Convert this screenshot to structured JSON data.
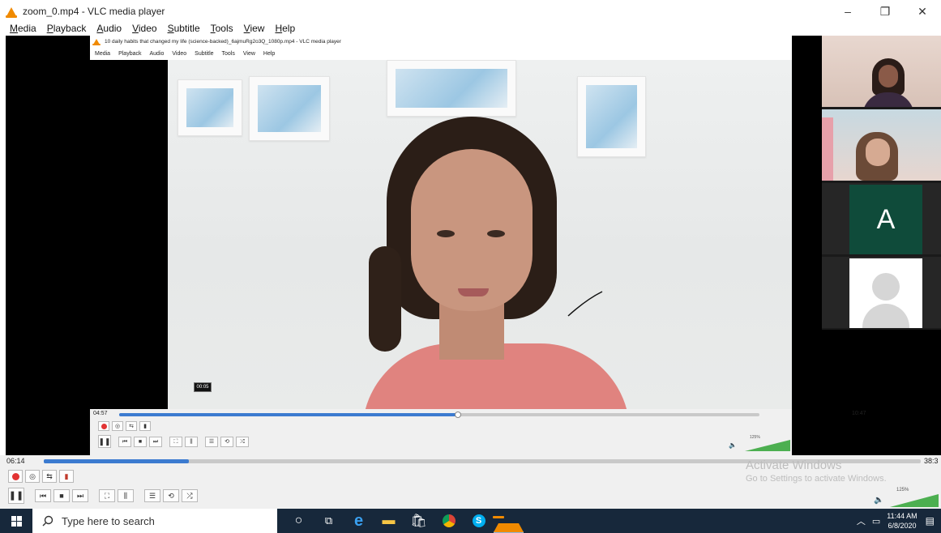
{
  "window": {
    "title": "zoom_0.mp4 - VLC media player",
    "menu": [
      "Media",
      "Playback",
      "Audio",
      "Video",
      "Subtitle",
      "Tools",
      "View",
      "Help"
    ],
    "controls": {
      "minimize": "–",
      "maximize": "❐",
      "close": "✕"
    }
  },
  "inner_window": {
    "title": "10 daily habits that changed my life (science-backed)_6ajmuRg2o3Q_1080p.mp4 - VLC media player",
    "menu": [
      "Media",
      "Playback",
      "Audio",
      "Video",
      "Subtitle",
      "Tools",
      "View",
      "Help"
    ],
    "elapsed": "04:57",
    "total": "10:47",
    "progress": 0.47,
    "seek_tooltip": "00:05",
    "volume_label": "125%",
    "volume_level": 1.0
  },
  "zoom_panel": {
    "tiles": [
      {
        "type": "video"
      },
      {
        "type": "video"
      },
      {
        "type": "initial",
        "letter": "A"
      },
      {
        "type": "avatar"
      }
    ]
  },
  "player": {
    "elapsed": "06:14",
    "total": "38:3",
    "progress": 0.165,
    "volume_label": "125%",
    "volume_level": 1.0
  },
  "watermark": {
    "line1": "Activate Windows",
    "line2": "Go to Settings to activate Windows."
  },
  "taskbar": {
    "search_placeholder": "Type here to search",
    "time": "11:44 AM",
    "date": "6/8/2020",
    "pinned": [
      "cortana-icon",
      "task-view-icon",
      "edge-icon",
      "file-explorer-icon",
      "store-icon",
      "chrome-icon",
      "skype-icon",
      "vlc-icon"
    ]
  },
  "colors": {
    "seek_fill": "#3c7bd0",
    "taskbar_bg": "#17283b",
    "vlc_orange": "#f08a00",
    "zoom_tile_green": "#0f4b3a"
  }
}
